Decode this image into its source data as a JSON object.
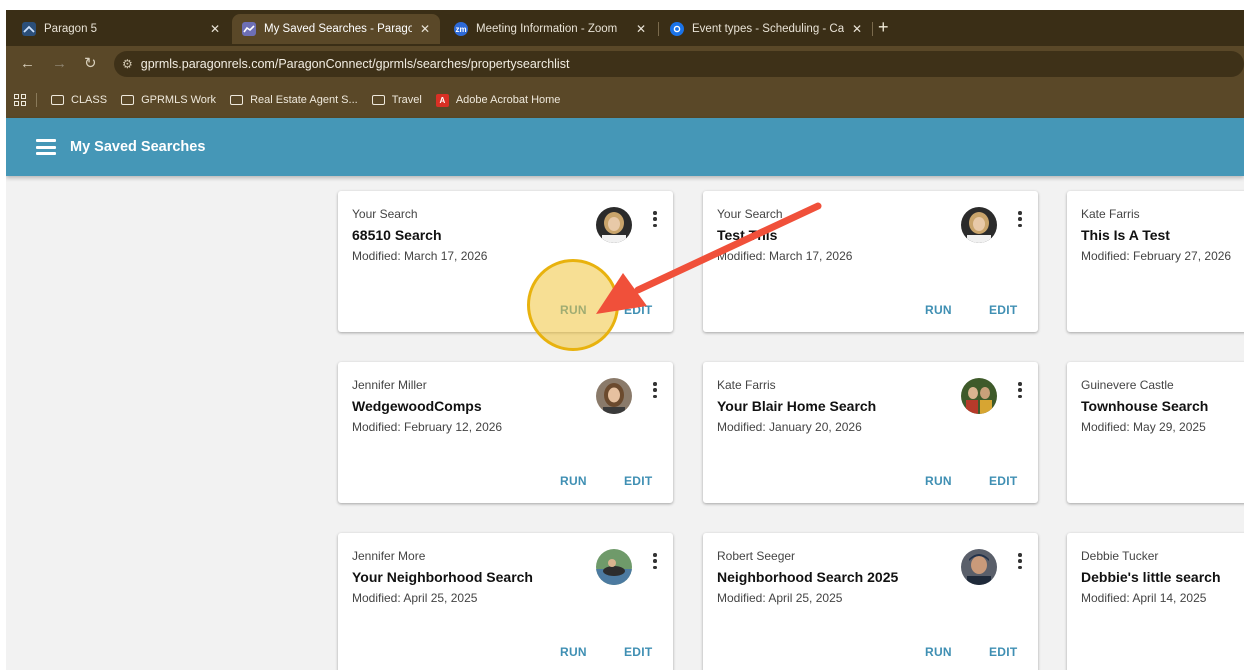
{
  "browser": {
    "tabs": [
      {
        "title": "Paragon 5",
        "favicon_color": "#2b4f7a"
      },
      {
        "title": "My Saved Searches - Paragon C",
        "favicon_color": "#6d6fb5",
        "active": true
      },
      {
        "title": "Meeting Information - Zoom",
        "favicon_color": "#2d6ad8",
        "favicon_text": "zm"
      },
      {
        "title": "Event types - Scheduling - Cale",
        "favicon_color": "#1a73e8"
      }
    ],
    "url": "gprmls.paragonrels.com/ParagonConnect/gprmls/searches/propertysearchlist",
    "bookmarks": [
      "CLASS",
      "GPRMLS Work",
      "Real Estate Agent S...",
      "Travel",
      "Adobe Acrobat Home"
    ]
  },
  "appbar": {
    "title": "My Saved Searches",
    "color": "#4597b7"
  },
  "labels": {
    "run": "RUN",
    "edit": "EDIT"
  },
  "cards": [
    {
      "owner": "Your Search",
      "name": "68510 Search",
      "modified": "Modified: March 17, 2026",
      "has_avatar": true
    },
    {
      "owner": "Your Search",
      "name": "Test This",
      "modified": "Modified: March 17, 2026",
      "has_avatar": true
    },
    {
      "owner": "Kate Farris",
      "name": "This Is A Test",
      "modified": "Modified: February 27, 2026",
      "has_avatar": false
    },
    {
      "owner": "Jennifer Miller",
      "name": "WedgewoodComps",
      "modified": "Modified: February 12, 2026",
      "has_avatar": true
    },
    {
      "owner": "Kate Farris",
      "name": "Your Blair Home Search",
      "modified": "Modified: January 20, 2026",
      "has_avatar": true
    },
    {
      "owner": "Guinevere Castle",
      "name": "Townhouse Search",
      "modified": "Modified: May 29, 2025",
      "has_avatar": false
    },
    {
      "owner": "Jennifer More",
      "name": "Your Neighborhood Search",
      "modified": "Modified: April 25, 2025",
      "has_avatar": true
    },
    {
      "owner": "Robert Seeger",
      "name": "Neighborhood Search 2025",
      "modified": "Modified: April 25, 2025",
      "has_avatar": true
    },
    {
      "owner": "Debbie Tucker",
      "name": "Debbie's little search",
      "modified": "Modified: April 14, 2025",
      "has_avatar": false
    }
  ],
  "annotation": {
    "highlight_color": "#e8b20e",
    "arrow_color": "#f0503a"
  }
}
